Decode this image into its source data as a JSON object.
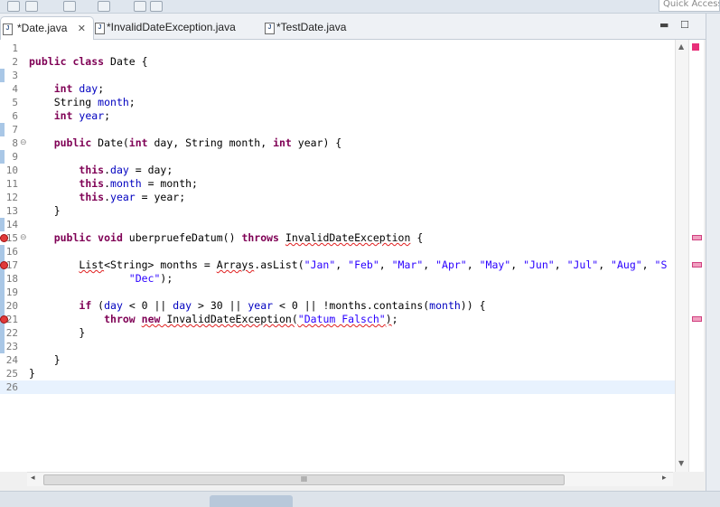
{
  "quick_access": {
    "placeholder": "Quick Access"
  },
  "tabs": [
    {
      "label": "*Date.java",
      "active": true
    },
    {
      "label": "*InvalidDateException.java",
      "active": false
    },
    {
      "label": "*TestDate.java",
      "active": false
    }
  ],
  "hscroll_grip": "III",
  "lines": [
    {
      "num": "1",
      "html": ""
    },
    {
      "num": "2",
      "html": "<span class=\"kw\">public class</span> Date {"
    },
    {
      "num": "3",
      "html": ""
    },
    {
      "num": "4",
      "html": "    <span class=\"kw\">int</span> <span class=\"fld\">day</span>;"
    },
    {
      "num": "5",
      "html": "    String <span class=\"fld\">month</span>;"
    },
    {
      "num": "6",
      "html": "    <span class=\"kw\">int</span> <span class=\"fld\">year</span>;"
    },
    {
      "num": "7",
      "html": ""
    },
    {
      "num": "8",
      "html": "    <span class=\"kw\">public</span> Date(<span class=\"kw\">int</span> day, String month, <span class=\"kw\">int</span> year) {"
    },
    {
      "num": "9",
      "html": ""
    },
    {
      "num": "10",
      "html": "        <span class=\"kw\">this</span>.<span class=\"fld\">day</span> = day;"
    },
    {
      "num": "11",
      "html": "        <span class=\"kw\">this</span>.<span class=\"fld\">month</span> = month;"
    },
    {
      "num": "12",
      "html": "        <span class=\"kw\">this</span>.<span class=\"fld\">year</span> = year;"
    },
    {
      "num": "13",
      "html": "    }"
    },
    {
      "num": "14",
      "html": ""
    },
    {
      "num": "15",
      "html": "    <span class=\"kw\">public void</span> uberpruefeDatum() <span class=\"kw\">throws</span> <span class=\"err\">InvalidDateException</span> {"
    },
    {
      "num": "16",
      "html": ""
    },
    {
      "num": "17",
      "html": "        <span class=\"err\">List</span>&lt;String&gt; months = <span class=\"err\">Arrays</span>.asList(<span class=\"str\">\"Jan\"</span>, <span class=\"str\">\"Feb\"</span>, <span class=\"str\">\"Mar\"</span>, <span class=\"str\">\"Apr\"</span>, <span class=\"str\">\"May\"</span>, <span class=\"str\">\"Jun\"</span>, <span class=\"str\">\"Jul\"</span>, <span class=\"str\">\"Aug\"</span>, <span class=\"str\">\"S</span>"
    },
    {
      "num": "18",
      "html": "                <span class=\"str\">\"Dec\"</span>);"
    },
    {
      "num": "19",
      "html": ""
    },
    {
      "num": "20",
      "html": "        <span class=\"kw\">if</span> (<span class=\"fld\">day</span> &lt; 0 || <span class=\"fld\">day</span> &gt; 30 || <span class=\"fld\">year</span> &lt; 0 || !months.contains(<span class=\"fld\">month</span>)) {"
    },
    {
      "num": "21",
      "html": "            <span class=\"kw\">throw</span> <span class=\"err\"><span class=\"kw\">new</span> InvalidDateException(<span class=\"str\">\"Datum Falsch\"</span>)</span>;"
    },
    {
      "num": "22",
      "html": "        }"
    },
    {
      "num": "23",
      "html": ""
    },
    {
      "num": "24",
      "html": "    }"
    },
    {
      "num": "25",
      "html": "}"
    },
    {
      "num": "26",
      "html": ""
    }
  ],
  "colors": {
    "keyword": "#7f0055",
    "field": "#0000c0",
    "string": "#2a00ff",
    "error": "#e02020",
    "current_line": "#e8f2fe"
  }
}
